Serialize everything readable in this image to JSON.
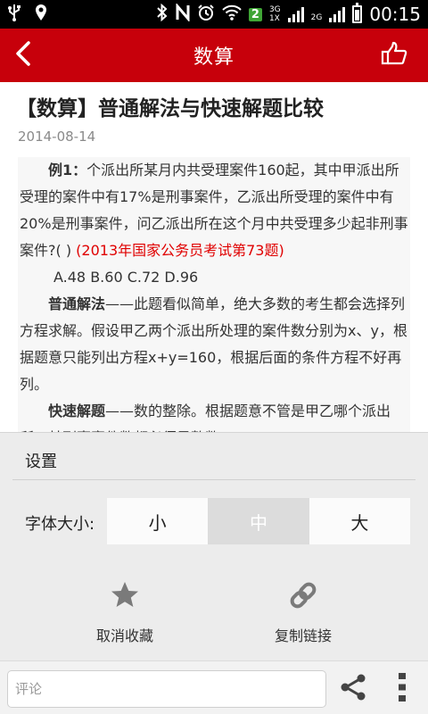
{
  "status_bar": {
    "icons": [
      "usb-icon",
      "location-icon",
      "bluetooth-icon",
      "nfc-icon",
      "alarm-icon",
      "wifi-icon"
    ],
    "badge": "2",
    "net_top": "3G",
    "net_bottom": "1X",
    "net2": "2G",
    "time": "00:15"
  },
  "header": {
    "title": "数算",
    "back_icon": "chevron-left-icon",
    "like_icon": "thumbs-up-icon",
    "color": "#c7000b"
  },
  "article": {
    "title": "【数算】普通解法与快速解题比较",
    "date": "2014-08-14",
    "p1_label": "例1：",
    "p1_text": "个派出所某月内共受理案件160起，其中甲派出所受理的案件中有17%是刑事案件，乙派出所受理的案件中有20%是刑事案件，问乙派出所在这个月中共受理多少起非刑事案件?( ) ",
    "p1_source": "(2013年国家公务员考试第73题)",
    "options": "A.48 B.60 C.72 D.96",
    "p2_label": "普通解法",
    "p2_text": "——此题看似简单，绝大多数的考生都会选择列方程求解。假设甲乙两个派出所处理的案件数分别为x、y，根据题意只能列出方程x+y=160，根据后面的条件方程不好再列。",
    "p3_label": "快速解题",
    "p3_text": "——数的整除。根据题意不管是甲乙哪个派出所，其刑事案件数都必须是整数。",
    "accent_color": "#e00000"
  },
  "settings": {
    "title": "设置",
    "font_size_label": "字体大小:",
    "sizes": [
      "小",
      "中",
      "大"
    ],
    "selected": "中",
    "fav_label": "取消收藏",
    "copy_label": "复制链接"
  },
  "bottom_bar": {
    "comment_placeholder": "评论"
  }
}
